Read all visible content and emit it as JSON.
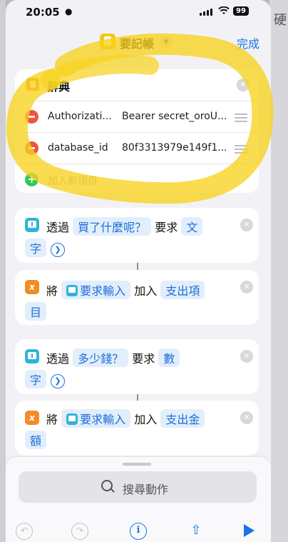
{
  "status_bar": {
    "time": "20:05",
    "battery": "99"
  },
  "header": {
    "title": "要記帳",
    "done_label": "完成"
  },
  "dictionary": {
    "title": "辭典",
    "rows": [
      {
        "key": "Authorizati...",
        "value": "Bearer secret_oroU..."
      },
      {
        "key": "database_id",
        "value": "80f3313979e149f1..."
      }
    ],
    "add_label": "加入新項目"
  },
  "actions": [
    {
      "verb": "透過",
      "token": "買了什麼呢？",
      "mid": "要求",
      "token2a": "文",
      "token2b": "字"
    },
    {
      "verb": "將",
      "token": "要求輸入",
      "mid": "加入",
      "token2a": "支出項",
      "token2b": "目"
    },
    {
      "verb": "透過",
      "token": "多少錢？",
      "mid": "要求",
      "token2a": "數",
      "token2b": "字"
    },
    {
      "verb": "將",
      "token": "要求輸入",
      "mid": "加入",
      "token2a": "支出金",
      "token2b": "額"
    }
  ],
  "search": {
    "placeholder": "搜尋動作"
  },
  "background": {
    "glyph": "硬"
  },
  "colors": {
    "accent": "#1a73e8",
    "token_bg": "#e3eefc",
    "highlight": "#f7d21e",
    "delete": "#f2533a",
    "add": "#34c759"
  }
}
